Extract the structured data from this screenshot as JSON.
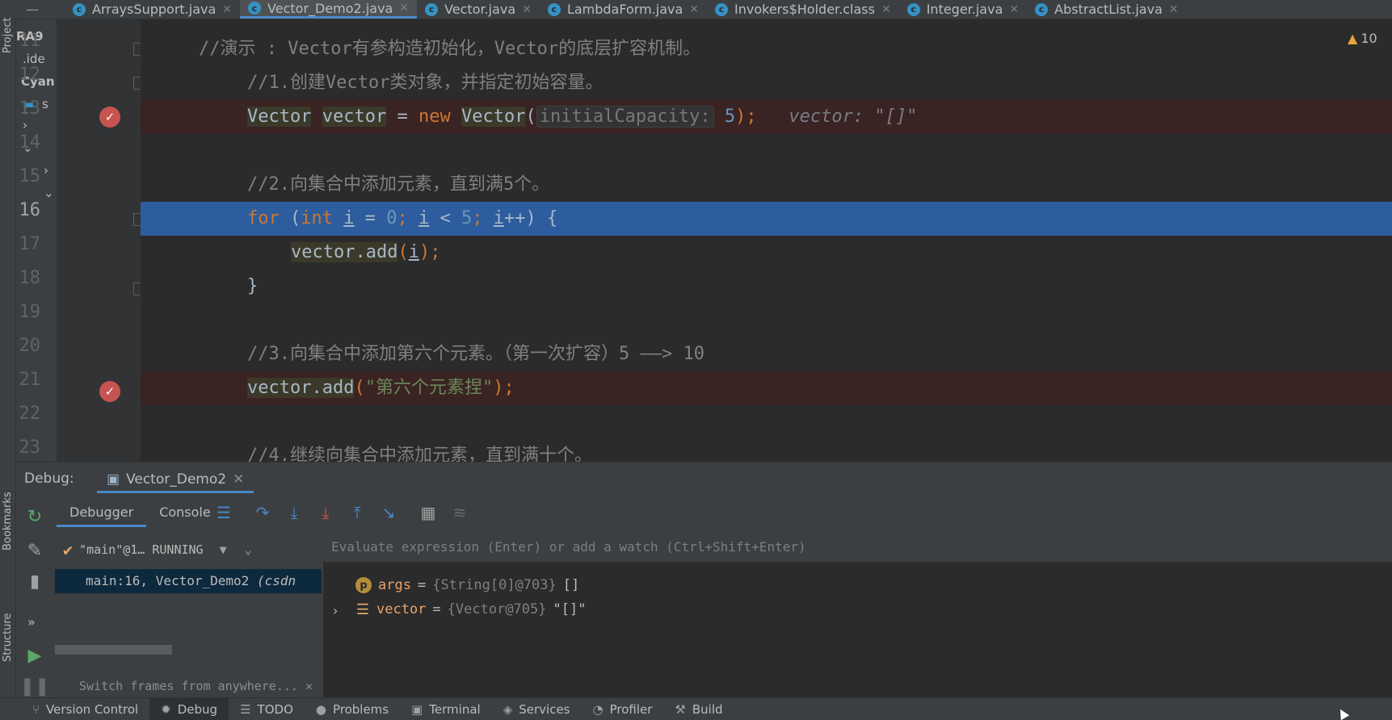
{
  "tabs": [
    {
      "label": "ArraysSupport.java",
      "active": false
    },
    {
      "label": "Vector_Demo2.java",
      "active": true
    },
    {
      "label": "Vector.java",
      "active": false
    },
    {
      "label": "LambdaForm.java",
      "active": false
    },
    {
      "label": "Invokers$Holder.class",
      "active": false
    },
    {
      "label": "Integer.java",
      "active": false
    },
    {
      "label": "AbstractList.java",
      "active": false
    }
  ],
  "tab_icon_letter": "c",
  "left_strip": {
    "project_label": "Project",
    "bookmarks_label": "Bookmarks",
    "structure_label": "Structure"
  },
  "project_panel": {
    "item1": "RA9",
    "item2": ".ide",
    "item3": "Cyan",
    "item4": "s"
  },
  "editor": {
    "warning_count": "10",
    "lines": [
      {
        "num": "11",
        "text": "//演示 : Vector有参构造初始化，Vector的底层扩容机制。"
      },
      {
        "num": "12",
        "text": "//1.创建Vector类对象，并指定初始容量。"
      },
      {
        "num": "13",
        "code_type": "Vector",
        "code_var": "vector",
        "code_eq": " = ",
        "code_new": "new",
        "code_ctor": "Vector",
        "code_open": "(",
        "param_hint": "initialCapacity:",
        "code_arg": "5",
        "code_close": ");",
        "inline_value": "vector: \"[]\""
      },
      {
        "num": "14",
        "text": ""
      },
      {
        "num": "15",
        "text": "//2.向集合中添加元素，直到满5个。"
      },
      {
        "num": "16",
        "kw_for": "for",
        "p1": " (",
        "kw_int": "int",
        "v1": " ",
        "ivar": "i",
        "eq": " = ",
        "zero": "0",
        "semi1": "; ",
        "ivar2": "i",
        "lt": " < ",
        "five": "5",
        "semi2": "; ",
        "ivar3": "i",
        "inc": "++) {"
      },
      {
        "num": "17",
        "call": "vector.add",
        "open": "(",
        "arg": "i",
        "close": ");"
      },
      {
        "num": "18",
        "text": "}"
      },
      {
        "num": "19",
        "text": ""
      },
      {
        "num": "20",
        "text": "//3.向集合中添加第六个元素。（第一次扩容）5 ——> 10"
      },
      {
        "num": "21",
        "call": "vector.add",
        "open": "(",
        "str": "\"第六个元素捏\"",
        "close": ");"
      },
      {
        "num": "22",
        "text": ""
      },
      {
        "num": "23",
        "text": "//4.继续向集合中添加元素，直到满十个。"
      }
    ]
  },
  "debug": {
    "header": "Debug:",
    "session": "Vector_Demo2",
    "tabs": [
      "Debugger",
      "Console"
    ],
    "thread": "\"main\"@1… RUNNING",
    "frame_main": "main:16, Vector_Demo2",
    "frame_pkg": "(csdn",
    "switch_frames": "Switch frames from anywhere...",
    "eval_placeholder": "Evaluate expression (Enter) or add a watch (Ctrl+Shift+Enter)",
    "variables": [
      {
        "icon": "p",
        "name": "args",
        "eq": " = ",
        "type": "{String[0]@703}",
        "value": "[]"
      },
      {
        "icon": "field",
        "name": "vector",
        "eq": " = ",
        "type": "{Vector@705}",
        "value": "\"[]\""
      }
    ]
  },
  "statusbar": [
    "Version Control",
    "Debug",
    "TODO",
    "Problems",
    "Terminal",
    "Services",
    "Profiler",
    "Build"
  ]
}
